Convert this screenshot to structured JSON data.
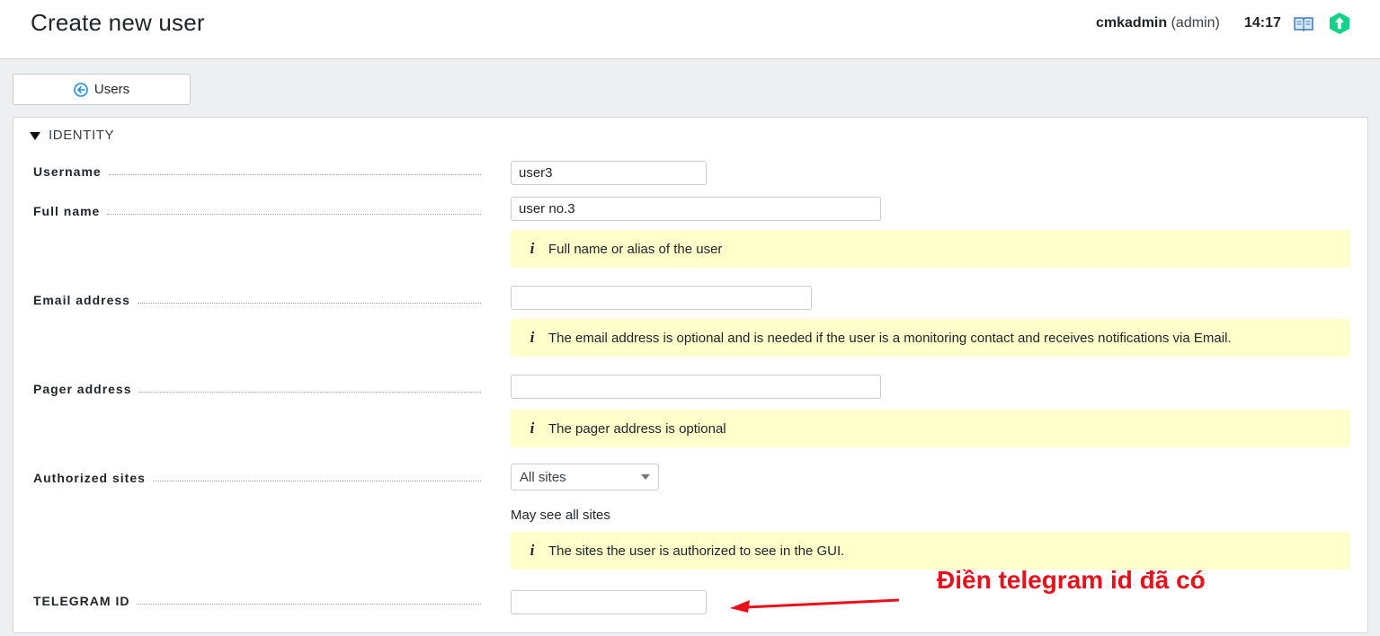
{
  "header": {
    "title": "Create new user",
    "user_name": "cmkadmin",
    "user_role": "(admin)",
    "time": "14:17",
    "icons": [
      "book-icon",
      "checkmk-logo-icon"
    ]
  },
  "back_button": {
    "label": "Users",
    "icon": "back-arrow-icon"
  },
  "section": {
    "title": "IDENTITY"
  },
  "fields": {
    "username": {
      "label": "Username",
      "value": "user3"
    },
    "full_name": {
      "label": "Full name",
      "value": "user no.3",
      "help": "Full name or alias of the user"
    },
    "email": {
      "label": "Email address",
      "value": "",
      "help": "The email address is optional and is needed if the user is a monitoring contact and receives notifications via Email."
    },
    "pager": {
      "label": "Pager address",
      "value": "",
      "help": "The pager address is optional"
    },
    "sites": {
      "label": "Authorized sites",
      "selected": "All sites",
      "note": "May see all sites",
      "help": "The sites the user is authorized to see in the GUI."
    },
    "telegram": {
      "label": "TELEGRAM ID",
      "value": ""
    }
  },
  "annotation": {
    "text": "Điền telegram id đã có",
    "color": "#e8101a"
  },
  "colors": {
    "help_bg": "#ffffcc",
    "accent": "#13d389",
    "back_icon": "#1b8de0"
  }
}
